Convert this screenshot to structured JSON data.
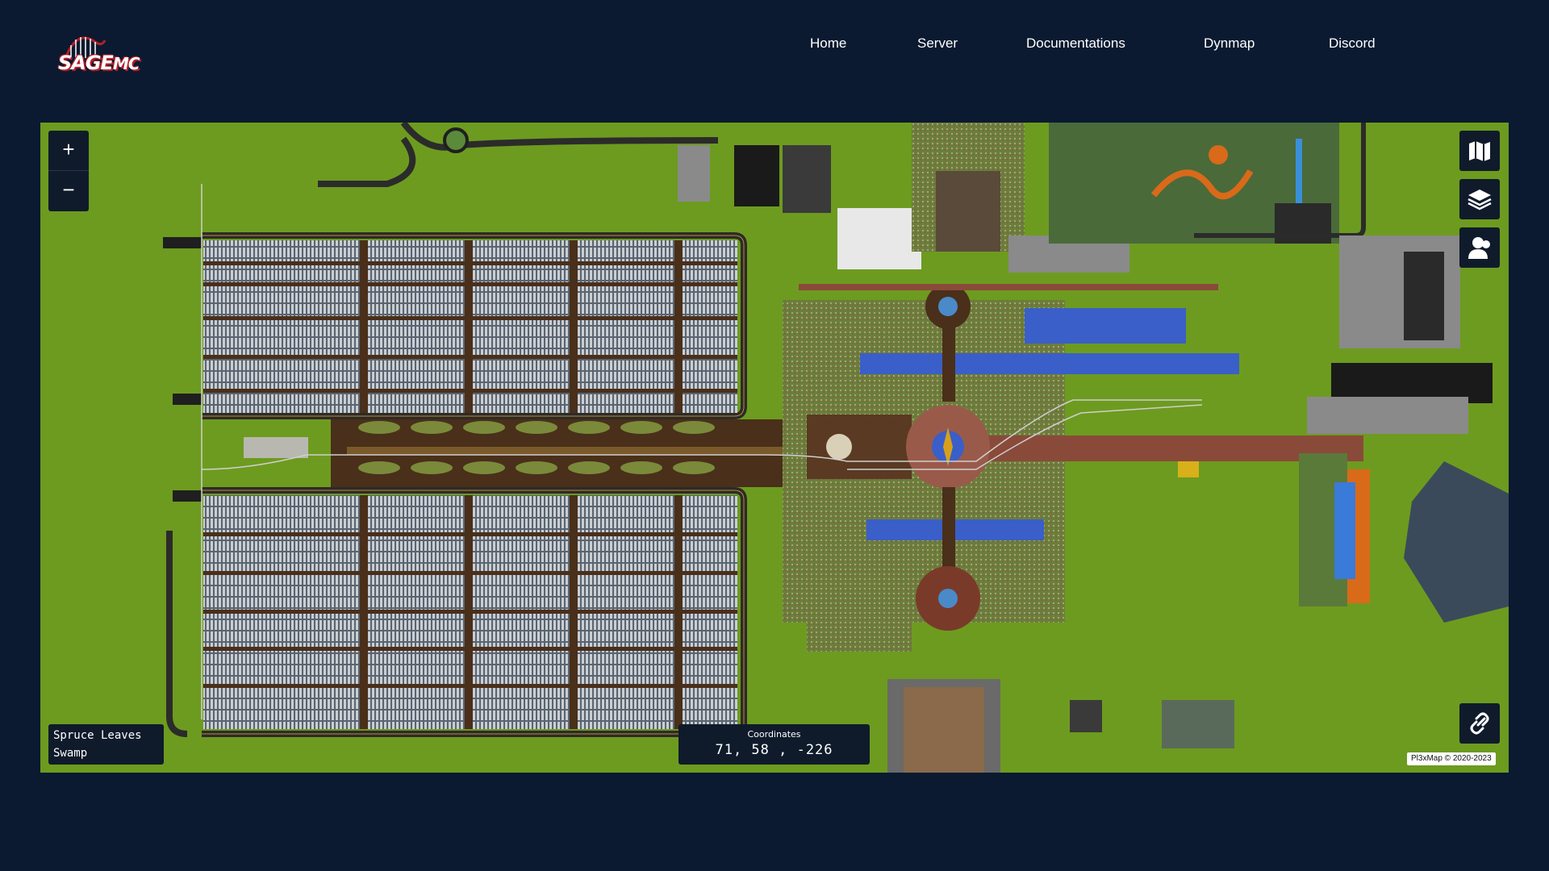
{
  "header": {
    "logo": {
      "text_main": "SAGE",
      "text_sub": "MC"
    },
    "nav": [
      {
        "label": "Home"
      },
      {
        "label": "Server"
      },
      {
        "label": "Documentations"
      },
      {
        "label": "Dynmap"
      },
      {
        "label": "Discord"
      }
    ]
  },
  "map": {
    "zoom_in_label": "+",
    "zoom_out_label": "−",
    "block_info": {
      "block": "Spruce Leaves",
      "biome": "Swamp"
    },
    "coordinates": {
      "label": "Coordinates",
      "value": "71, 58 , -226"
    },
    "attribution": "Pl3xMap © 2020-2023",
    "side_buttons": [
      {
        "icon": "map-icon"
      },
      {
        "icon": "layers-icon"
      },
      {
        "icon": "players-icon"
      },
      {
        "icon": "link-icon"
      }
    ]
  },
  "colors": {
    "page_bg": "#0b1a30",
    "grass": "#6d9b1f",
    "control_bg": "#0f1b2b",
    "road": "#4a2f1a",
    "water": "#3a5fc8"
  }
}
